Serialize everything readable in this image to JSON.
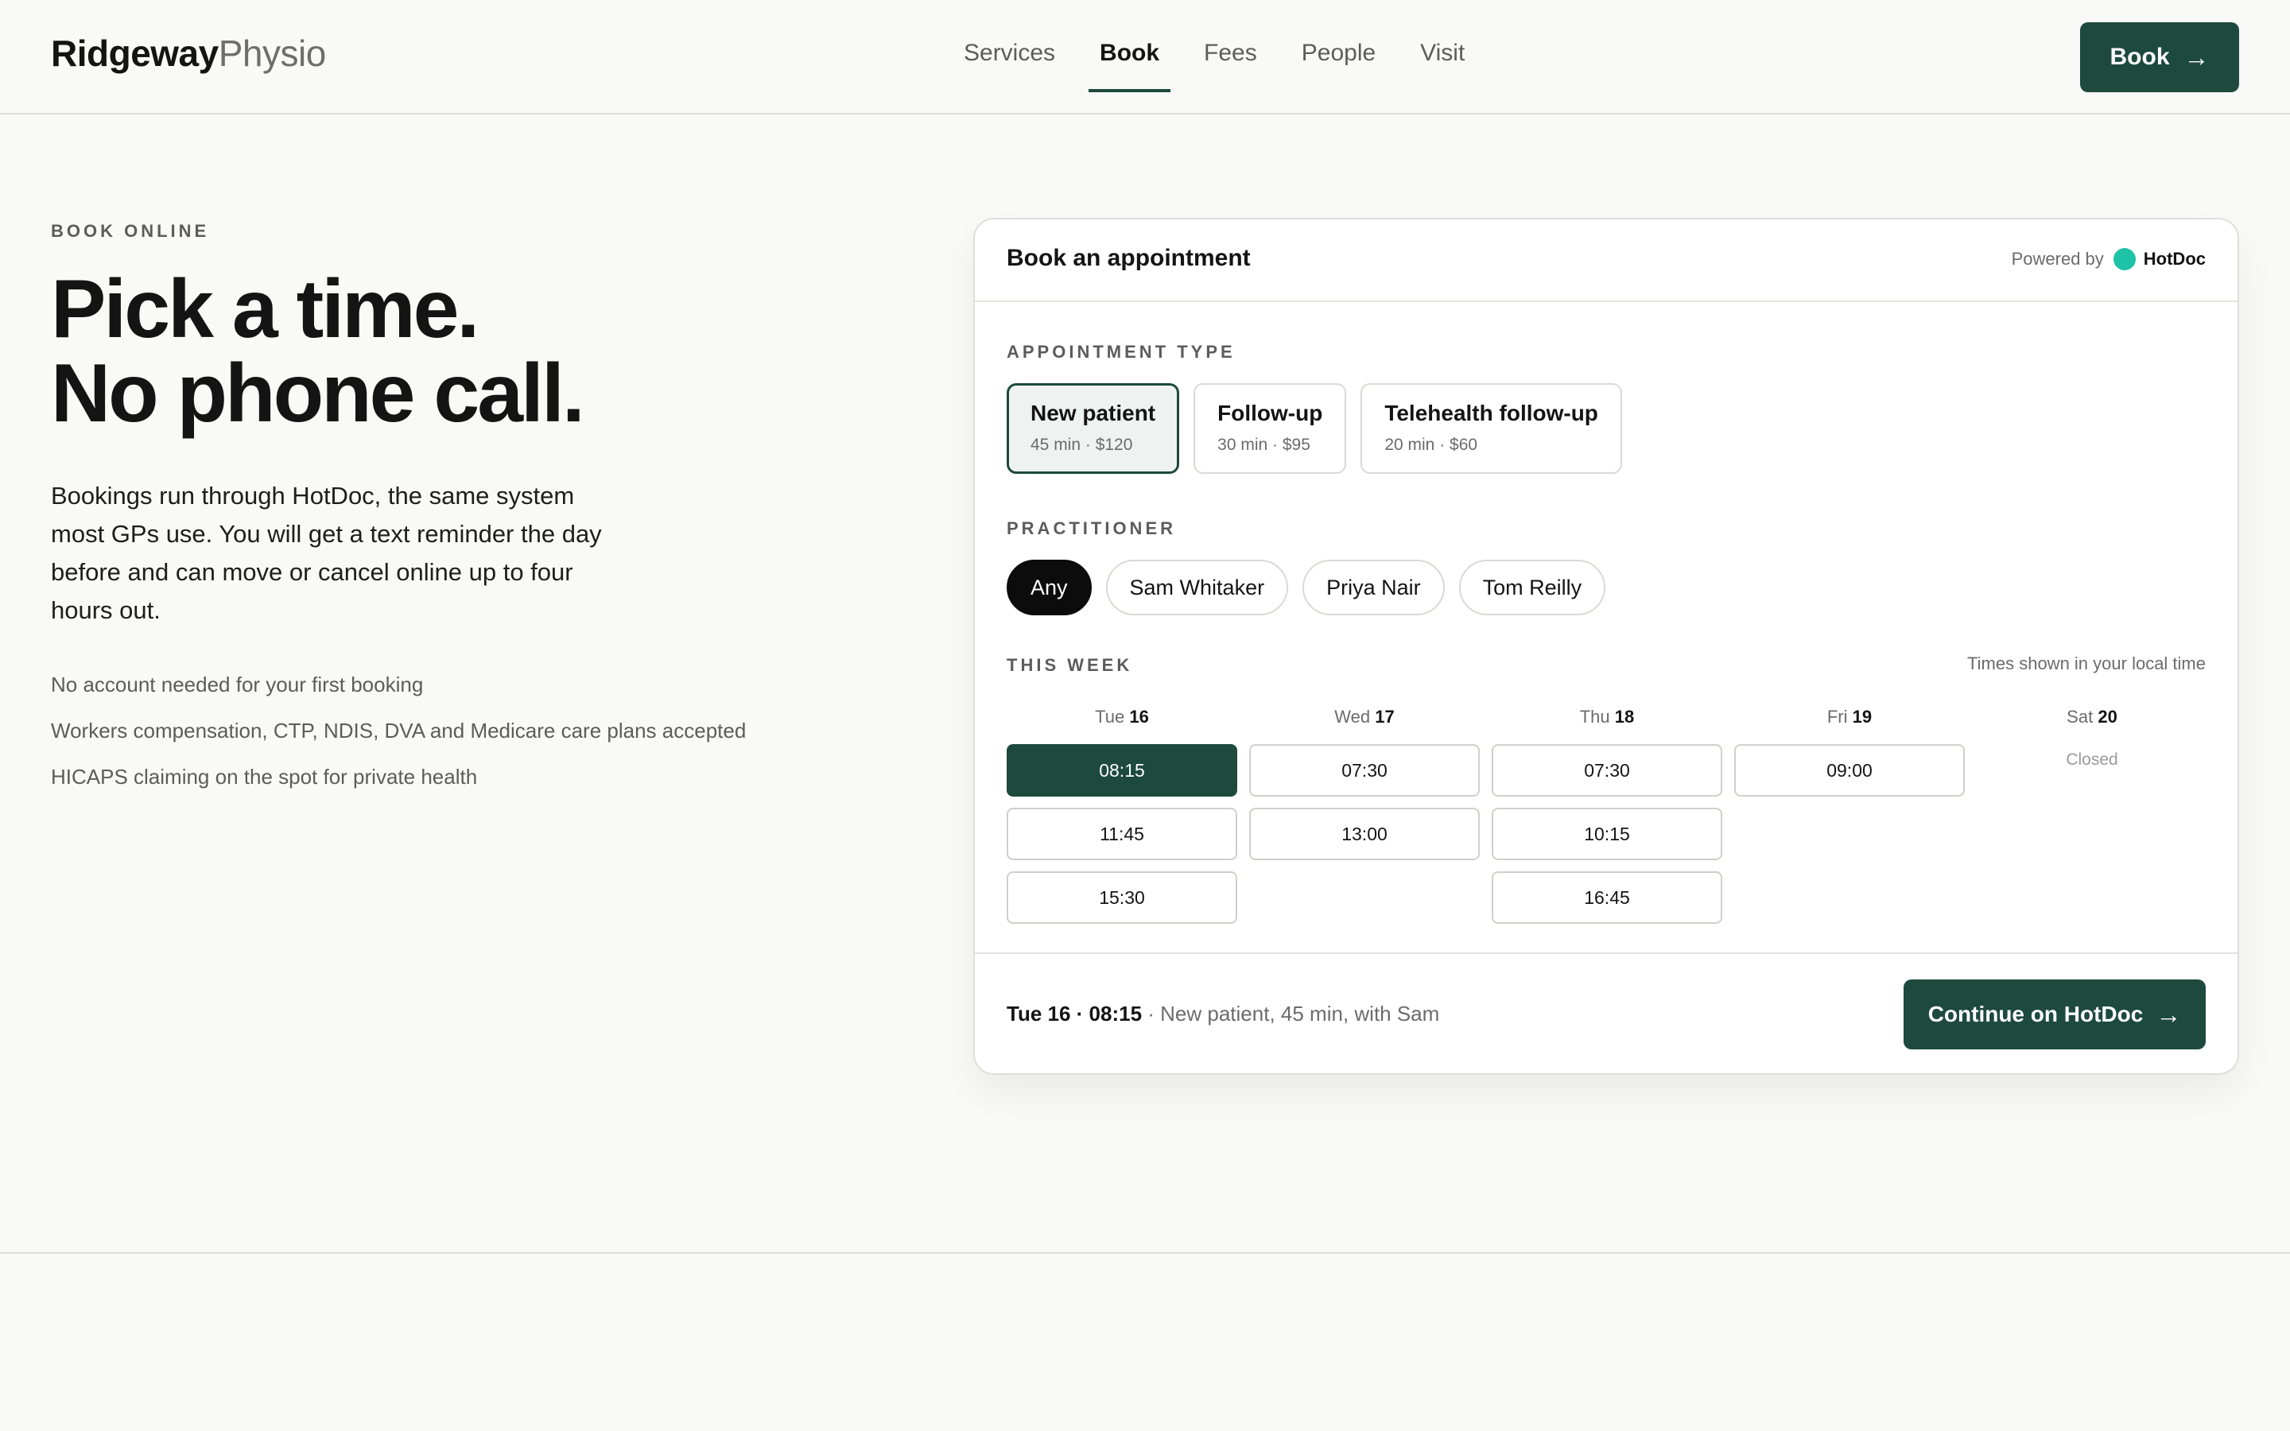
{
  "header": {
    "brand_bold": "Ridgeway",
    "brand_light": "Physio",
    "nav": [
      {
        "label": "Services"
      },
      {
        "label": "Book"
      },
      {
        "label": "Fees"
      },
      {
        "label": "People"
      },
      {
        "label": "Visit"
      }
    ],
    "active_nav": "Book",
    "book_button": "Book",
    "book_arrow": "→"
  },
  "hero": {
    "eyebrow": "BOOK ONLINE",
    "headline_line1": "Pick a time.",
    "headline_line2": "No phone call.",
    "lede": "Bookings run through HotDoc, the same system most GPs use. You will get a text reminder the day before and can move or cancel online up to four hours out.",
    "features": [
      "No account needed for your first booking",
      "Workers compensation, CTP, NDIS, DVA and Medicare care plans accepted",
      "HICAPS claiming on the spot for private health"
    ]
  },
  "widget": {
    "title": "Book an appointment",
    "powered_by": "Powered by",
    "provider": "HotDoc",
    "provider_color": "#1ec3a7",
    "appointment_type_label": "APPOINTMENT TYPE",
    "types": [
      {
        "title": "New patient",
        "sub": "45 min · $120",
        "selected": true
      },
      {
        "title": "Follow-up",
        "sub": "30 min · $95",
        "selected": false
      },
      {
        "title": "Telehealth follow-up",
        "sub": "20 min · $60",
        "selected": false
      }
    ],
    "practitioner_label": "PRACTITIONER",
    "practitioners": [
      {
        "name": "Any",
        "selected": true
      },
      {
        "name": "Sam Whitaker",
        "selected": false
      },
      {
        "name": "Priya Nair",
        "selected": false
      },
      {
        "name": "Tom Reilly",
        "selected": false
      }
    ],
    "week_label": "THIS WEEK",
    "local_time_note": "Times shown in your local time",
    "days": [
      {
        "dow": "Tue",
        "date": "16",
        "slots": [
          "08:15",
          "11:45",
          "15:30"
        ],
        "selected_slot": "08:15"
      },
      {
        "dow": "Wed",
        "date": "17",
        "slots": [
          "07:30",
          "13:00"
        ]
      },
      {
        "dow": "Thu",
        "date": "18",
        "slots": [
          "07:30",
          "10:15",
          "16:45"
        ]
      },
      {
        "dow": "Fri",
        "date": "19",
        "slots": [
          "09:00"
        ]
      },
      {
        "dow": "Sat",
        "date": "20",
        "slots": [],
        "closed_label": "Closed"
      }
    ],
    "summary_strong": "Tue 16 · 08:15",
    "summary_rest": " · New patient, 45 min, with Sam",
    "continue_button": "Continue on HotDoc",
    "continue_arrow": "→"
  },
  "colors": {
    "accent": "#1d4a3c",
    "background": "#f9f9f7"
  }
}
